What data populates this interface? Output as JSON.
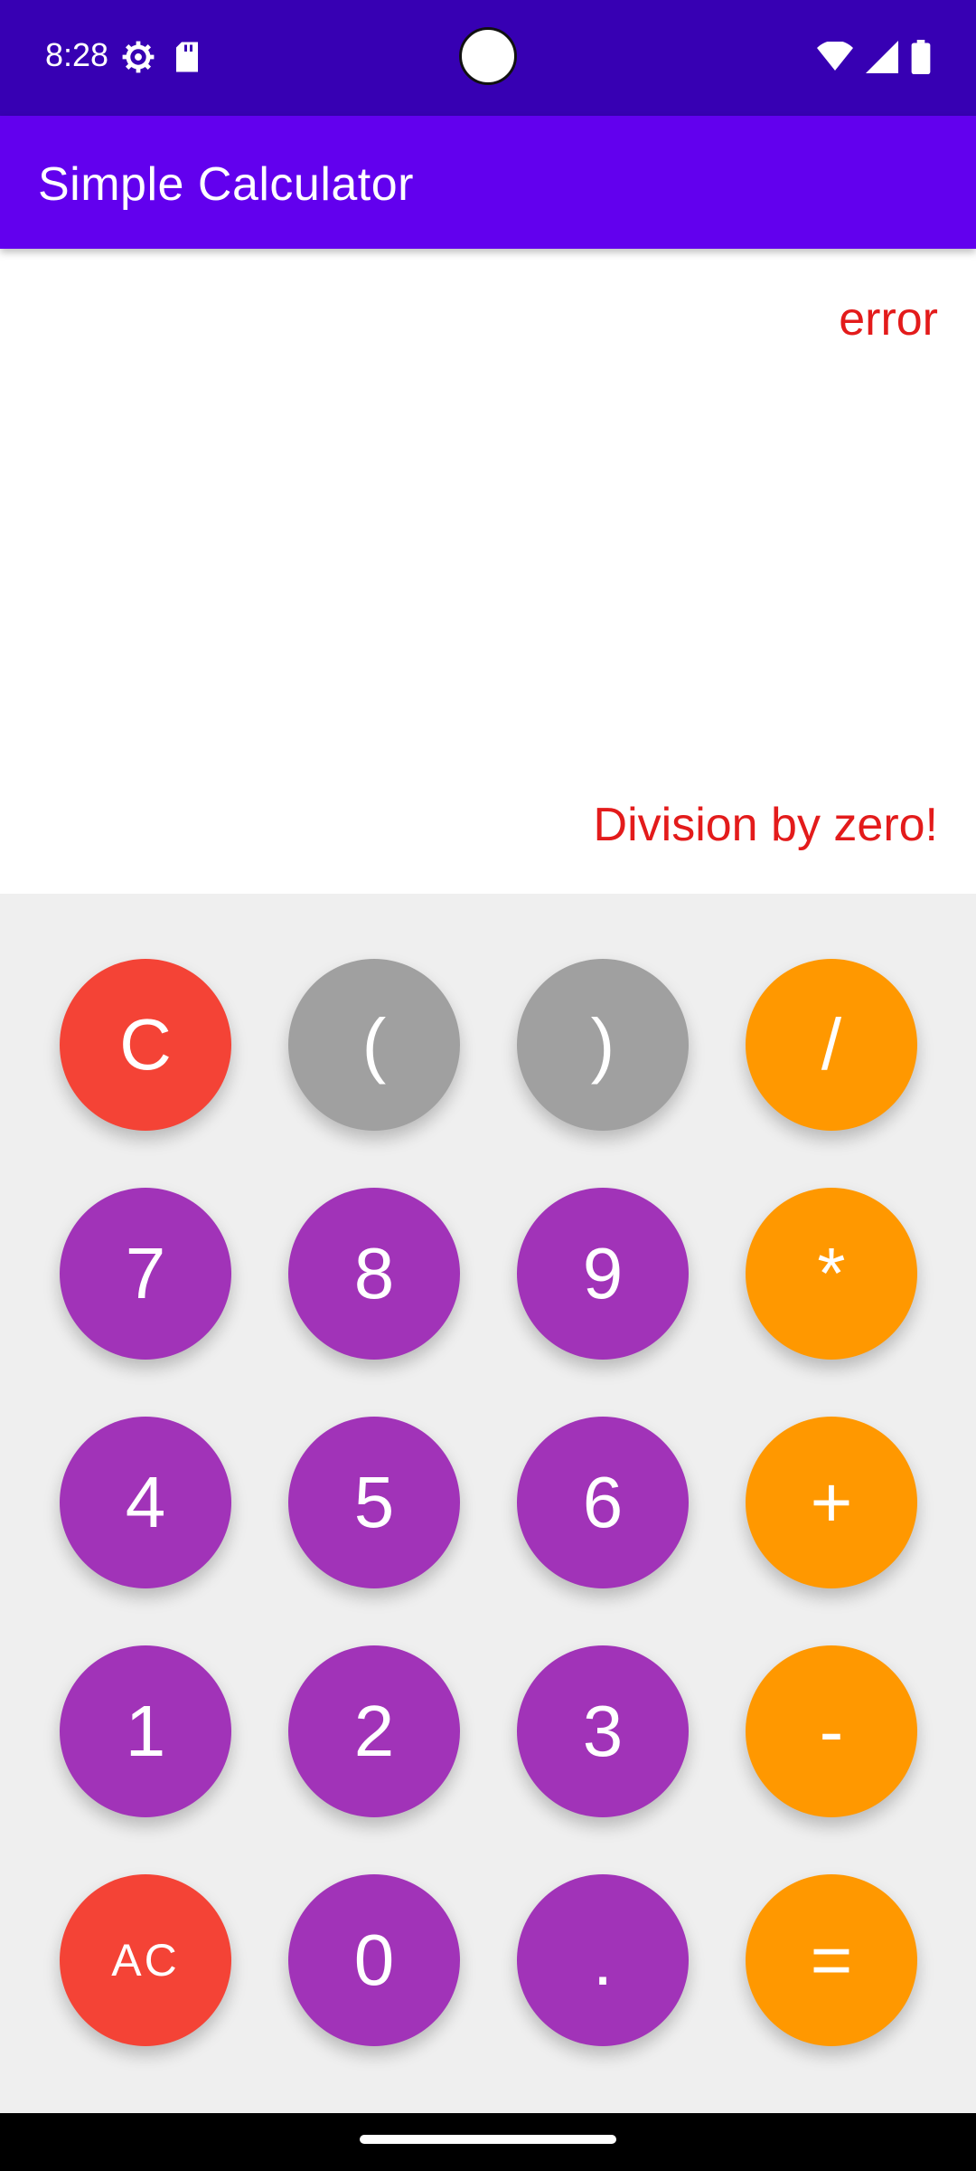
{
  "status_bar": {
    "time": "8:28",
    "left_icons": [
      "settings-icon",
      "sd-card-icon"
    ],
    "right_icons": [
      "wifi-icon",
      "signal-icon",
      "battery-icon"
    ]
  },
  "app_bar": {
    "title": "Simple Calculator"
  },
  "display": {
    "expression": "error",
    "result": "Division by zero!",
    "text_color": "#e31b1b"
  },
  "keypad": {
    "colors": {
      "clear": "#f44336",
      "paren": "#a0a0a0",
      "operator": "#ff9800",
      "digit": "#a133b8"
    },
    "keys": [
      {
        "label": "C",
        "role": "clear"
      },
      {
        "label": "(",
        "role": "paren"
      },
      {
        "label": ")",
        "role": "paren"
      },
      {
        "label": "/",
        "role": "operator"
      },
      {
        "label": "7",
        "role": "digit"
      },
      {
        "label": "8",
        "role": "digit"
      },
      {
        "label": "9",
        "role": "digit"
      },
      {
        "label": "*",
        "role": "operator"
      },
      {
        "label": "4",
        "role": "digit"
      },
      {
        "label": "5",
        "role": "digit"
      },
      {
        "label": "6",
        "role": "digit"
      },
      {
        "label": "+",
        "role": "operator"
      },
      {
        "label": "1",
        "role": "digit"
      },
      {
        "label": "2",
        "role": "digit"
      },
      {
        "label": "3",
        "role": "digit"
      },
      {
        "label": "-",
        "role": "operator"
      },
      {
        "label": "AC",
        "role": "clear"
      },
      {
        "label": "0",
        "role": "digit"
      },
      {
        "label": ".",
        "role": "digit"
      },
      {
        "label": "=",
        "role": "operator"
      }
    ]
  }
}
